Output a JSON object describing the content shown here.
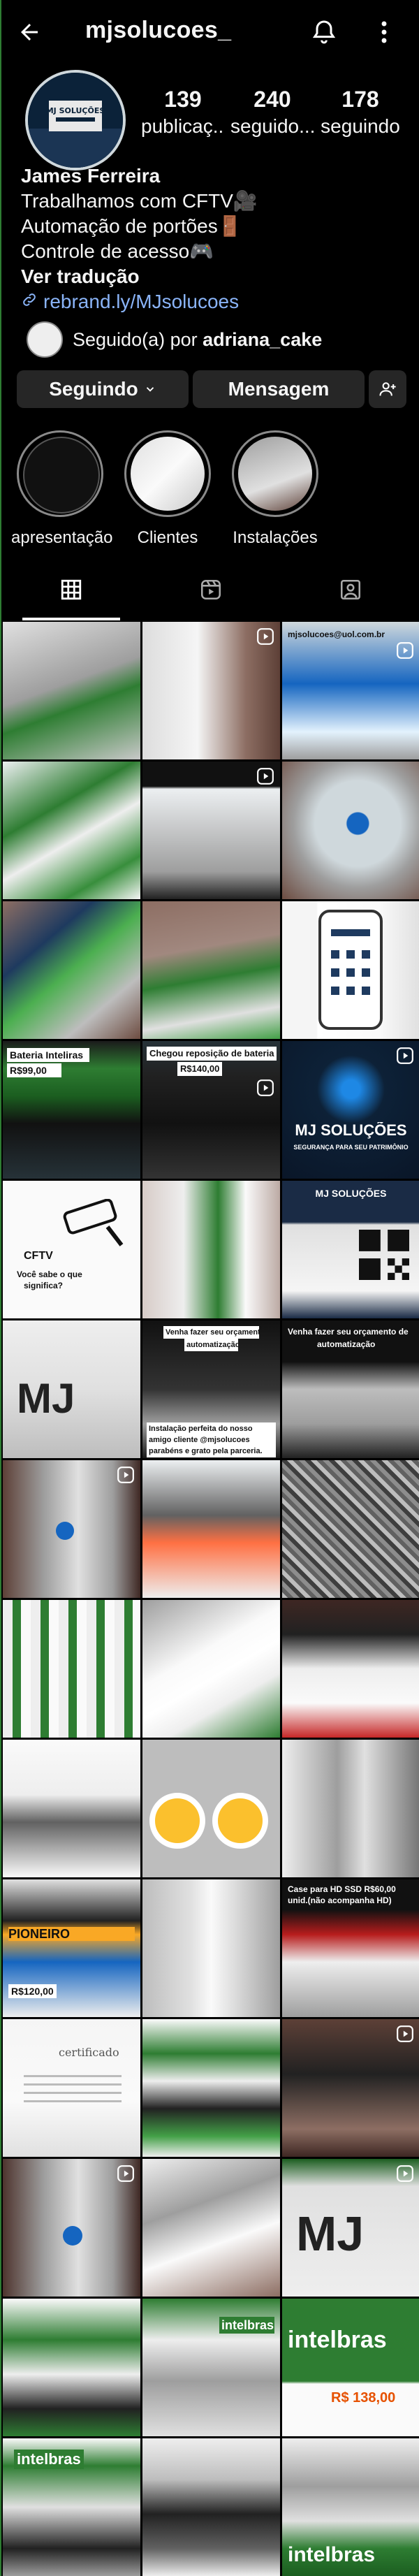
{
  "header": {
    "username": "mjsolucoes_"
  },
  "profile": {
    "posts": "139",
    "posts_label": "publicaç...",
    "followers": "240",
    "followers_label": "seguido...",
    "following": "178",
    "following_label": "seguindo"
  },
  "bio": {
    "name": "James Ferreira",
    "line1": "Trabalhamos com CFTV🎥",
    "line2": "Automação de portões🚪",
    "line3": "Controle de acesso🎮",
    "translate": "Ver tradução",
    "link": "rebrand.ly/MJsolucoes"
  },
  "followed_by": {
    "prefix": "Seguido(a) por ",
    "user": "adriana_cake"
  },
  "buttons": {
    "follow": "Seguindo",
    "message": "Mensagem"
  },
  "highlights": [
    {
      "label": "apresentação"
    },
    {
      "label": "Clientes"
    },
    {
      "label": "Instalações"
    }
  ],
  "grid_overlays": {
    "c2": "mjsolucoes@uol.com.br",
    "c11": "Bateria Inteliras",
    "c11b": "R$99,00",
    "c12": "Chegou reposição de bateria",
    "c12b": "R$140,00",
    "c13": "MJ SOLUÇÕES",
    "c13b": "SEGURANÇA PARA SEU PATRIMÔNIO",
    "c14a": "CFTV",
    "c14b": "Você sabe o que",
    "c14c": "significa?",
    "c16": "MJ SOLUÇÕES",
    "c18a": "Venha fazer seu orçamento de",
    "c18b": "automatização",
    "c17a": "Venha fazer seu orçamento de",
    "c17b": "automatização!",
    "c17c": "Instalação perfeita do nosso",
    "c17d": "amigo cliente @mjsolucoes",
    "c17e": "parabéns e grato pela parceria.",
    "c28a": "PIONEIRO",
    "c28b": "R$120,00",
    "c30a": "Case para HD SSD R$60,00",
    "c30b": "unid.(não acompanha HD)",
    "c31": "certificado",
    "c41": "intelbras",
    "c41b": "R$ 138,00",
    "c43": "intelbras",
    "c45": "intelbras"
  }
}
